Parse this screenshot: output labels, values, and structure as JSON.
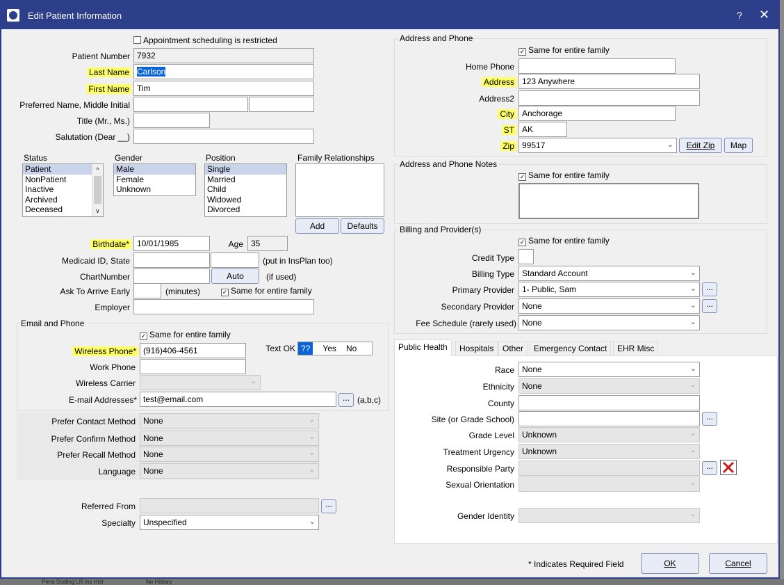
{
  "window": {
    "title": "Edit Patient Information",
    "help": "?",
    "close": "✕"
  },
  "left": {
    "appt_restricted": "Appointment scheduling is restricted",
    "patient_number": {
      "label": "Patient Number",
      "value": "7932"
    },
    "last_name": {
      "label": "Last Name",
      "value": "Carlson"
    },
    "first_name": {
      "label": "First Name",
      "value": "Tim"
    },
    "preferred_name": {
      "label": "Preferred Name, Middle Initial",
      "value": "",
      "mi": ""
    },
    "title": {
      "label": "Title (Mr., Ms.)",
      "value": ""
    },
    "salutation": {
      "label": "Salutation (Dear __)",
      "value": ""
    },
    "status": {
      "label": "Status",
      "items": [
        "Patient",
        "NonPatient",
        "Inactive",
        "Archived",
        "Deceased"
      ],
      "selected": "Patient"
    },
    "gender": {
      "label": "Gender",
      "items": [
        "Male",
        "Female",
        "Unknown"
      ],
      "selected": "Male"
    },
    "position": {
      "label": "Position",
      "items": [
        "Single",
        "Married",
        "Child",
        "Widowed",
        "Divorced"
      ],
      "selected": "Single"
    },
    "family": {
      "label": "Family Relationships",
      "add": "Add",
      "defaults": "Defaults"
    },
    "birthdate": {
      "label": "Birthdate*",
      "value": "10/01/1985"
    },
    "age": {
      "label": "Age",
      "value": "35"
    },
    "medicaid": {
      "label": "Medicaid ID, State",
      "value": "",
      "state": "",
      "note": "(put in InsPlan too)"
    },
    "chart_number": {
      "label": "ChartNumber",
      "value": "",
      "auto": "Auto",
      "note": "(if used)"
    },
    "arrive_early": {
      "label": "Ask To Arrive Early",
      "value": "",
      "unit": "(minutes)",
      "same_family": "Same for entire family"
    },
    "employer": {
      "label": "Employer",
      "value": ""
    },
    "email_phone": {
      "title": "Email and Phone",
      "same_family": "Same for entire family",
      "wireless_phone": {
        "label": "Wireless Phone*",
        "value": "(916)406-4561"
      },
      "text_ok": {
        "label": "Text OK",
        "options": [
          "??",
          "Yes",
          "No"
        ],
        "selected": "??"
      },
      "work_phone": {
        "label": "Work Phone",
        "value": ""
      },
      "wireless_carrier": {
        "label": "Wireless Carrier",
        "value": ""
      },
      "email": {
        "label": "E-mail Addresses*",
        "value": "test@email.com",
        "dots": "...",
        "note": "(a,b,c)"
      }
    },
    "prefer_contact": {
      "label": "Prefer Contact Method",
      "value": "None"
    },
    "prefer_confirm": {
      "label": "Prefer Confirm Method",
      "value": "None"
    },
    "prefer_recall": {
      "label": "Prefer Recall Method",
      "value": "None"
    },
    "language": {
      "label": "Language",
      "value": "None"
    },
    "referred_from": {
      "label": "Referred From",
      "value": ""
    },
    "specialty": {
      "label": "Specialty",
      "value": "Unspecified"
    }
  },
  "right": {
    "address_phone": {
      "title": "Address and Phone",
      "same_family": "Same for entire family",
      "home_phone": {
        "label": "Home Phone",
        "value": ""
      },
      "address": {
        "label": "Address",
        "value": "123 Anywhere"
      },
      "address2": {
        "label": "Address2",
        "value": ""
      },
      "city": {
        "label": "City",
        "value": "Anchorage"
      },
      "st": {
        "label": "ST",
        "value": "AK"
      },
      "zip": {
        "label": "Zip",
        "value": "99517"
      },
      "edit_zip": "Edit Zip",
      "map": "Map"
    },
    "notes": {
      "title": "Address and Phone Notes",
      "same_family": "Same for entire family",
      "value": ""
    },
    "billing": {
      "title": "Billing and Provider(s)",
      "same_family": "Same for entire family",
      "credit_type": {
        "label": "Credit Type",
        "value": ""
      },
      "billing_type": {
        "label": "Billing Type",
        "value": "Standard Account"
      },
      "primary_provider": {
        "label": "Primary Provider",
        "value": "1- Public, Sam"
      },
      "secondary_provider": {
        "label": "Secondary Provider",
        "value": "None"
      },
      "fee_schedule": {
        "label": "Fee Schedule (rarely used)",
        "value": "None"
      }
    },
    "tabs": [
      "Public Health",
      "Hospitals",
      "Other",
      "Emergency Contact",
      "EHR Misc"
    ],
    "public_health": {
      "race": {
        "label": "Race",
        "value": "None"
      },
      "ethnicity": {
        "label": "Ethnicity",
        "value": "None"
      },
      "county": {
        "label": "County",
        "value": ""
      },
      "site": {
        "label": "Site (or Grade School)",
        "value": ""
      },
      "grade_level": {
        "label": "Grade Level",
        "value": "Unknown"
      },
      "treatment_urgency": {
        "label": "Treatment Urgency",
        "value": "Unknown"
      },
      "responsible_party": {
        "label": "Responsible Party",
        "value": ""
      },
      "sexual_orientation": {
        "label": "Sexual Orientation",
        "value": ""
      },
      "gender_identity": {
        "label": "Gender Identity",
        "value": ""
      }
    },
    "required_note": "* Indicates Required Field",
    "ok": "OK",
    "cancel": "Cancel"
  },
  "background": {
    "bottom_text": "Perio Scaling LR Ins Hist",
    "bottom_text2": "No History"
  },
  "colors": {
    "titlebar": "#2d3e8a",
    "highlight": "#ffff66",
    "selection": "#0a64d8"
  }
}
